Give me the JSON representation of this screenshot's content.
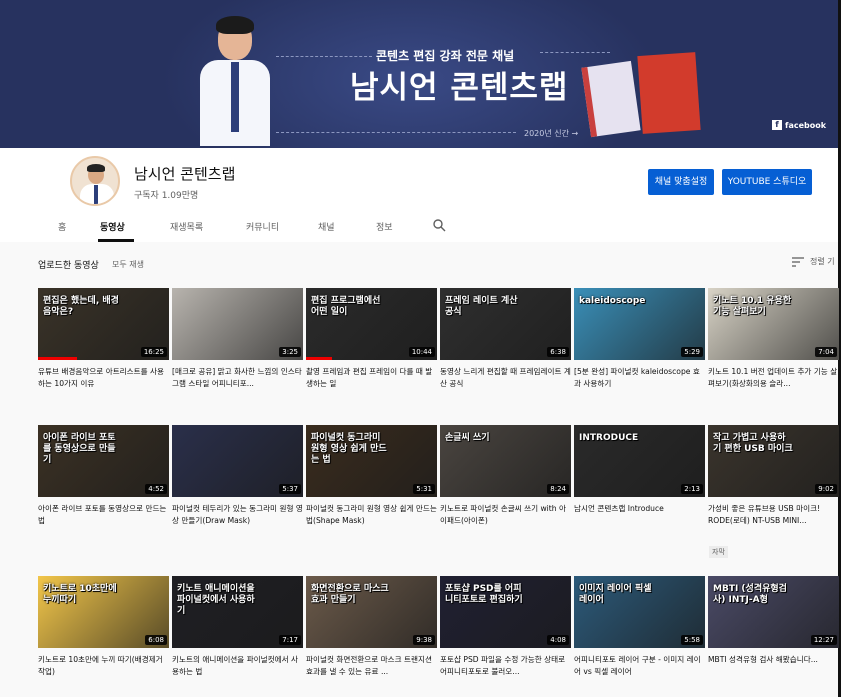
{
  "banner": {
    "subtitle": "콘텐츠 편집 강좌 전문 채널",
    "name": "남시언 콘텐츠랩",
    "since": "2020년 신간 →",
    "facebook": "facebook"
  },
  "channel": {
    "name": "남시언 콘텐츠랩",
    "subscribers": "구독자 1.09만명",
    "customize_label": "채널 맞춤설정",
    "studio_label": "YOUTUBE 스튜디오"
  },
  "tabs": [
    {
      "label": "홈"
    },
    {
      "label": "동영상"
    },
    {
      "label": "재생목록"
    },
    {
      "label": "커뮤니티"
    },
    {
      "label": "채널"
    },
    {
      "label": "정보"
    }
  ],
  "section": {
    "title": "업로드한 동영상",
    "play_all": "모두 재생",
    "sort": "정렬 기"
  },
  "videos": [
    {
      "title": "유튜브 배경음악으로 아트리스트를 사용하는 10가지 이유",
      "duration": "16:25",
      "thumb_text": "편집은 했는데, 배경 음악은?",
      "bg": "#3a3328",
      "progress": 0.3
    },
    {
      "title": "[매크로 공유] 맑고 화사한 느낌의 인스타그램 스타일 어피니티포...",
      "duration": "3:25",
      "thumb_text": "",
      "bg": "#b8b4ae",
      "progress": 0.0
    },
    {
      "title": "촬영 프레임과 편집 프레임이 다를 때 발생하는 일",
      "duration": "10:44",
      "thumb_text": "편집 프로그램에선 어떤 일이",
      "bg": "#2b2b2b",
      "progress": 0.2
    },
    {
      "title": "동영상 느리게 편집할 때 프레임레이트 계산 공식",
      "duration": "6:38",
      "thumb_text": "프레임 레이트 계산 공식",
      "bg": "#2f2f2f",
      "progress": 0.0
    },
    {
      "title": "[5분 완성] 파이널컷 kaleidoscope 효과 사용하기",
      "duration": "5:29",
      "thumb_text": "kaleidoscope",
      "bg": "#3a8fb8",
      "progress": 0.0
    },
    {
      "title": "키노트 10.1 버전 업데이트 추가 기능 살펴보기(화상화의용 슬라...",
      "duration": "7:04",
      "thumb_text": "키노트 10.1 유용한 기능 살펴보기",
      "bg": "#d8d3c6",
      "progress": 0.0
    },
    {
      "title": "아이폰 라이브 포토를 동영상으로 만드는법",
      "duration": "4:52",
      "thumb_text": "아이폰 라이브 포토를 동영상으로 만들기",
      "bg": "#3b3124",
      "progress": 0.0
    },
    {
      "title": "파이널컷 테두리가 있는 동그라미 원형 영상 만들기(Draw Mask)",
      "duration": "5:37",
      "thumb_text": "",
      "bg": "#2a2f4a",
      "progress": 0.0
    },
    {
      "title": "파이널컷 동그라미 원형 영상 쉽게 만드는법(Shape Mask)",
      "duration": "5:31",
      "thumb_text": "파이널컷 동그라미 원형 영상 쉽게 만드는 법",
      "bg": "#3a2c1e",
      "progress": 0.0
    },
    {
      "title": "키노트로 파이널컷 손글씨 쓰기 with 아이패드(아이폰)",
      "duration": "8:24",
      "thumb_text": "손글씨 쓰기",
      "bg": "#4a4540",
      "progress": 0.0
    },
    {
      "title": "남시언 콘텐츠랩 Introduce",
      "duration": "2:13",
      "thumb_text": "INTRODUCE",
      "bg": "#2a2a2a",
      "progress": 0.0
    },
    {
      "title": "가성비 좋은 유튜브용 USB 마이크! RODE(로데) NT-USB MINI...",
      "duration": "9:02",
      "thumb_text": "작고 가볍고 사용하기 편한 USB 마이크",
      "bg": "#3a342c",
      "progress": 0.0
    },
    {
      "title": "키노트로 10초만에 누끼 따기(배경제거 작업)",
      "duration": "6:08",
      "thumb_text": "키노트로 10초만에 누끼따기",
      "bg": "#f2c64a",
      "progress": 0.0
    },
    {
      "title": "키노트의 애니메이션을 파이널컷에서 사용하는 법",
      "duration": "7:17",
      "thumb_text": "키노트 애니메이션을 파이널컷에서 사용하기",
      "bg": "#1f1f24",
      "progress": 0.0
    },
    {
      "title": "파이널컷 화면전환으로 마스크 트랜지션 효과를 낼 수 있는 유료 ...",
      "duration": "9:38",
      "thumb_text": "화면전환으로 마스크 효과 만들기",
      "bg": "#6b5a4a",
      "progress": 0.0
    },
    {
      "title": "포토샵 PSD 파일을 수정 가능한 상태로 어피니티포토로 불러오...",
      "duration": "4:08",
      "thumb_text": "포토샵 PSD를 어피니티포토로 편집하기",
      "bg": "#202032",
      "progress": 0.0
    },
    {
      "title": "어피니티포토 레이어 구분 - 이미지 레이어 vs 픽셀 레이어",
      "duration": "5:58",
      "thumb_text": "이미지 레이어 픽셀 레이어",
      "bg": "#2c5a7a",
      "progress": 0.0
    },
    {
      "title": "MBTI 성격유형 검사 해봤습니다...",
      "duration": "12:27",
      "thumb_text": "MBTI (성격유형검사) INTJ-A형",
      "bg": "#4a4a66",
      "progress": 0.0
    }
  ],
  "subtitle_badge": "자막",
  "colors": {
    "banner": "#27325f",
    "button": "#065fd4",
    "progress": "#e00000"
  }
}
